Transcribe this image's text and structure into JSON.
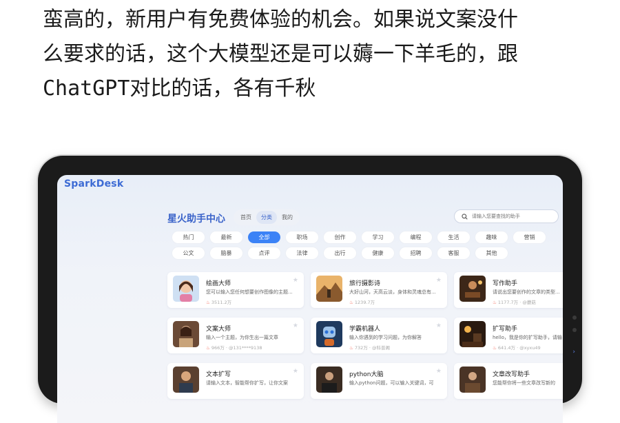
{
  "article": {
    "lines": [
      "蛮高的，新用户有免费体验的机会。如果说文案没什",
      "么要求的话，这个大模型还是可以薅一下羊毛的，跟",
      "ChatGPT对比的话，各有千秋"
    ]
  },
  "app": {
    "logo": "SparkDesk",
    "hub_title": "星火助手中心",
    "tabs": [
      {
        "label": "首页",
        "active": false
      },
      {
        "label": "分类",
        "active": true
      },
      {
        "label": "我的",
        "active": false
      }
    ],
    "search_placeholder": "请输入您要查找的助手",
    "categories_row1": [
      {
        "label": "热门",
        "active": false
      },
      {
        "label": "最新",
        "active": false
      },
      {
        "label": "全部",
        "active": true
      },
      {
        "label": "职场",
        "active": false
      },
      {
        "label": "创作",
        "active": false
      },
      {
        "label": "学习",
        "active": false
      },
      {
        "label": "编程",
        "active": false
      },
      {
        "label": "生活",
        "active": false
      },
      {
        "label": "趣味",
        "active": false
      },
      {
        "label": "营销",
        "active": false
      }
    ],
    "categories_row2": [
      {
        "label": "公文",
        "active": false
      },
      {
        "label": "脑暴",
        "active": false
      },
      {
        "label": "点评",
        "active": false
      },
      {
        "label": "法律",
        "active": false
      },
      {
        "label": "出行",
        "active": false
      },
      {
        "label": "健康",
        "active": false
      },
      {
        "label": "招聘",
        "active": false
      },
      {
        "label": "客服",
        "active": false
      },
      {
        "label": "其他",
        "active": false
      }
    ],
    "assistants": [
      {
        "name": "绘画大师",
        "desc": "您可以输入您任何想要创作图像的主题...",
        "meta": "3511.2万",
        "thumb": "girl"
      },
      {
        "name": "旅行摄影诗",
        "desc": "大好山河，天高云淡，身体和灵魂总有...",
        "meta": "1239.7万",
        "thumb": "mountain"
      },
      {
        "name": "写作助手",
        "desc": "请说出您要创作的文章的类型...",
        "meta": "1177.7万 · @蘑菇",
        "thumb": "desk"
      },
      {
        "name": "文案大师",
        "desc": "输入一个主题，为你生出一篇文章",
        "meta": "966万 · @131****9138",
        "thumb": "woman"
      },
      {
        "name": "学霸机器人",
        "desc": "输入你遇到的学习问题，为你解答",
        "meta": "732万 · @科普阁",
        "thumb": "robot"
      },
      {
        "name": "扩写助手",
        "desc": "hello，我是你的扩写助手，请输",
        "meta": "641.4万 · @xyxu49",
        "thumb": "lamp"
      },
      {
        "name": "文本扩写",
        "desc": "请输入文本，智能帮你扩写，让你文案",
        "meta": "",
        "thumb": "man"
      },
      {
        "name": "python大脑",
        "desc": "输入python问题，可以输入关键词，可",
        "meta": "",
        "thumb": "coder"
      },
      {
        "name": "文章改写助手",
        "desc": "您能帮你将一些文章改写新的",
        "meta": "",
        "thumb": "writer"
      }
    ]
  }
}
